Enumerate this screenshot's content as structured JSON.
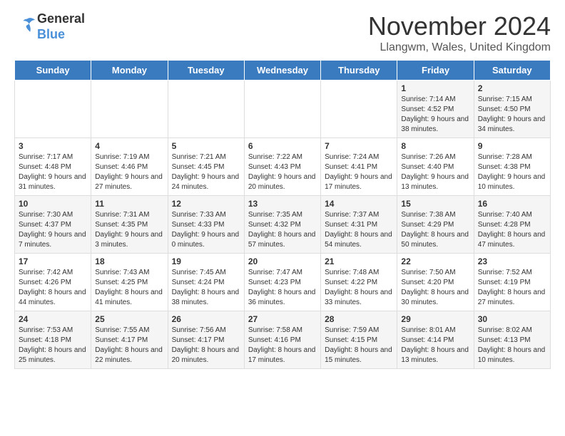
{
  "header": {
    "logo_text_general": "General",
    "logo_text_blue": "Blue",
    "month_title": "November 2024",
    "location": "Llangwm, Wales, United Kingdom"
  },
  "days_of_week": [
    "Sunday",
    "Monday",
    "Tuesday",
    "Wednesday",
    "Thursday",
    "Friday",
    "Saturday"
  ],
  "weeks": [
    [
      {
        "day": null
      },
      {
        "day": null
      },
      {
        "day": null
      },
      {
        "day": null
      },
      {
        "day": null
      },
      {
        "day": "1",
        "sunrise": "7:14 AM",
        "sunset": "4:52 PM",
        "daylight": "9 hours and 38 minutes."
      },
      {
        "day": "2",
        "sunrise": "7:15 AM",
        "sunset": "4:50 PM",
        "daylight": "9 hours and 34 minutes."
      }
    ],
    [
      {
        "day": "3",
        "sunrise": "7:17 AM",
        "sunset": "4:48 PM",
        "daylight": "9 hours and 31 minutes."
      },
      {
        "day": "4",
        "sunrise": "7:19 AM",
        "sunset": "4:46 PM",
        "daylight": "9 hours and 27 minutes."
      },
      {
        "day": "5",
        "sunrise": "7:21 AM",
        "sunset": "4:45 PM",
        "daylight": "9 hours and 24 minutes."
      },
      {
        "day": "6",
        "sunrise": "7:22 AM",
        "sunset": "4:43 PM",
        "daylight": "9 hours and 20 minutes."
      },
      {
        "day": "7",
        "sunrise": "7:24 AM",
        "sunset": "4:41 PM",
        "daylight": "9 hours and 17 minutes."
      },
      {
        "day": "8",
        "sunrise": "7:26 AM",
        "sunset": "4:40 PM",
        "daylight": "9 hours and 13 minutes."
      },
      {
        "day": "9",
        "sunrise": "7:28 AM",
        "sunset": "4:38 PM",
        "daylight": "9 hours and 10 minutes."
      }
    ],
    [
      {
        "day": "10",
        "sunrise": "7:30 AM",
        "sunset": "4:37 PM",
        "daylight": "9 hours and 7 minutes."
      },
      {
        "day": "11",
        "sunrise": "7:31 AM",
        "sunset": "4:35 PM",
        "daylight": "9 hours and 3 minutes."
      },
      {
        "day": "12",
        "sunrise": "7:33 AM",
        "sunset": "4:33 PM",
        "daylight": "9 hours and 0 minutes."
      },
      {
        "day": "13",
        "sunrise": "7:35 AM",
        "sunset": "4:32 PM",
        "daylight": "8 hours and 57 minutes."
      },
      {
        "day": "14",
        "sunrise": "7:37 AM",
        "sunset": "4:31 PM",
        "daylight": "8 hours and 54 minutes."
      },
      {
        "day": "15",
        "sunrise": "7:38 AM",
        "sunset": "4:29 PM",
        "daylight": "8 hours and 50 minutes."
      },
      {
        "day": "16",
        "sunrise": "7:40 AM",
        "sunset": "4:28 PM",
        "daylight": "8 hours and 47 minutes."
      }
    ],
    [
      {
        "day": "17",
        "sunrise": "7:42 AM",
        "sunset": "4:26 PM",
        "daylight": "8 hours and 44 minutes."
      },
      {
        "day": "18",
        "sunrise": "7:43 AM",
        "sunset": "4:25 PM",
        "daylight": "8 hours and 41 minutes."
      },
      {
        "day": "19",
        "sunrise": "7:45 AM",
        "sunset": "4:24 PM",
        "daylight": "8 hours and 38 minutes."
      },
      {
        "day": "20",
        "sunrise": "7:47 AM",
        "sunset": "4:23 PM",
        "daylight": "8 hours and 36 minutes."
      },
      {
        "day": "21",
        "sunrise": "7:48 AM",
        "sunset": "4:22 PM",
        "daylight": "8 hours and 33 minutes."
      },
      {
        "day": "22",
        "sunrise": "7:50 AM",
        "sunset": "4:20 PM",
        "daylight": "8 hours and 30 minutes."
      },
      {
        "day": "23",
        "sunrise": "7:52 AM",
        "sunset": "4:19 PM",
        "daylight": "8 hours and 27 minutes."
      }
    ],
    [
      {
        "day": "24",
        "sunrise": "7:53 AM",
        "sunset": "4:18 PM",
        "daylight": "8 hours and 25 minutes."
      },
      {
        "day": "25",
        "sunrise": "7:55 AM",
        "sunset": "4:17 PM",
        "daylight": "8 hours and 22 minutes."
      },
      {
        "day": "26",
        "sunrise": "7:56 AM",
        "sunset": "4:17 PM",
        "daylight": "8 hours and 20 minutes."
      },
      {
        "day": "27",
        "sunrise": "7:58 AM",
        "sunset": "4:16 PM",
        "daylight": "8 hours and 17 minutes."
      },
      {
        "day": "28",
        "sunrise": "7:59 AM",
        "sunset": "4:15 PM",
        "daylight": "8 hours and 15 minutes."
      },
      {
        "day": "29",
        "sunrise": "8:01 AM",
        "sunset": "4:14 PM",
        "daylight": "8 hours and 13 minutes."
      },
      {
        "day": "30",
        "sunrise": "8:02 AM",
        "sunset": "4:13 PM",
        "daylight": "8 hours and 10 minutes."
      }
    ]
  ],
  "labels": {
    "sunrise": "Sunrise:",
    "sunset": "Sunset:",
    "daylight": "Daylight:"
  }
}
